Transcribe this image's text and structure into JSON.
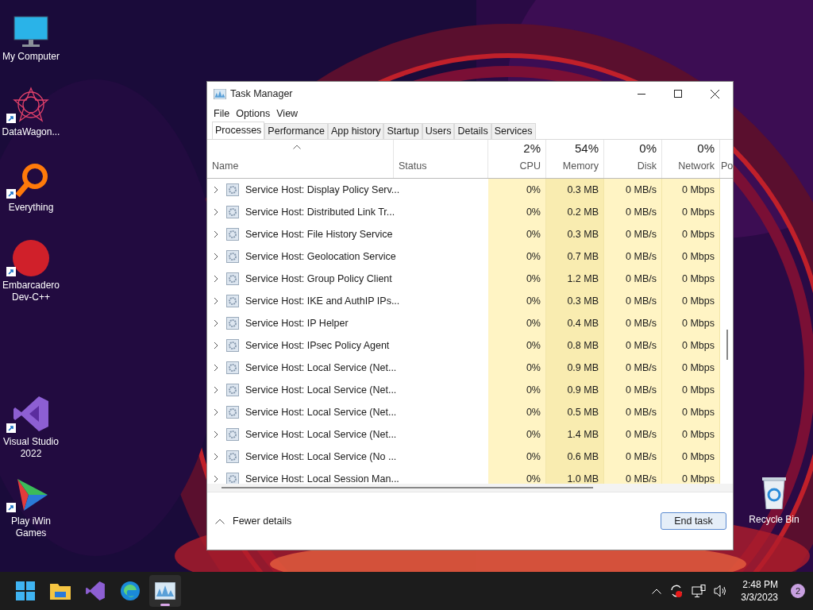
{
  "desktop_icons": [
    {
      "label": "My Computer",
      "kind": "monitor",
      "shortcut": false
    },
    {
      "label": "DataWagon...",
      "kind": "star",
      "shortcut": true
    },
    {
      "label": "Everything",
      "kind": "magnifier",
      "shortcut": true
    },
    {
      "label": "Embarcadero Dev-C++",
      "kind": "devcpp",
      "shortcut": true
    },
    {
      "label": "Visual Studio 2022",
      "kind": "vs",
      "shortcut": true
    },
    {
      "label": "Play iWin Games",
      "kind": "play",
      "shortcut": true
    }
  ],
  "recycle_bin": {
    "label": "Recycle Bin"
  },
  "window": {
    "title": "Task Manager",
    "menu": [
      "File",
      "Options",
      "View"
    ],
    "tabs": [
      {
        "label": "Processes",
        "selected": true
      },
      {
        "label": "Performance",
        "selected": false
      },
      {
        "label": "App history",
        "selected": false
      },
      {
        "label": "Startup",
        "selected": false
      },
      {
        "label": "Users",
        "selected": false
      },
      {
        "label": "Details",
        "selected": false
      },
      {
        "label": "Services",
        "selected": false
      }
    ],
    "columns": [
      {
        "label": "Name",
        "kind": "name"
      },
      {
        "label": "Status",
        "kind": "status"
      },
      {
        "label": "CPU",
        "total": "2%",
        "kind": "metric"
      },
      {
        "label": "Memory",
        "total": "54%",
        "kind": "metric"
      },
      {
        "label": "Disk",
        "total": "0%",
        "kind": "metric"
      },
      {
        "label": "Network",
        "total": "0%",
        "kind": "metric"
      },
      {
        "label": "Po",
        "kind": "cut"
      }
    ],
    "rows": [
      {
        "name": "Service Host: Display Policy Serv...",
        "cpu": "0%",
        "memory": "0.3 MB",
        "disk": "0 MB/s",
        "network": "0 Mbps",
        "expanded": false
      },
      {
        "name": "Service Host: Distributed Link Tr...",
        "cpu": "0%",
        "memory": "0.2 MB",
        "disk": "0 MB/s",
        "network": "0 Mbps",
        "expanded": false
      },
      {
        "name": "Service Host: File History Service",
        "cpu": "0%",
        "memory": "0.3 MB",
        "disk": "0 MB/s",
        "network": "0 Mbps",
        "expanded": false
      },
      {
        "name": "Service Host: Geolocation Service",
        "cpu": "0%",
        "memory": "0.7 MB",
        "disk": "0 MB/s",
        "network": "0 Mbps",
        "expanded": false
      },
      {
        "name": "Service Host: Group Policy Client",
        "cpu": "0%",
        "memory": "1.2 MB",
        "disk": "0 MB/s",
        "network": "0 Mbps",
        "expanded": false
      },
      {
        "name": "Service Host: IKE and AuthIP IPs...",
        "cpu": "0%",
        "memory": "0.3 MB",
        "disk": "0 MB/s",
        "network": "0 Mbps",
        "expanded": false
      },
      {
        "name": "Service Host: IP Helper",
        "cpu": "0%",
        "memory": "0.4 MB",
        "disk": "0 MB/s",
        "network": "0 Mbps",
        "expanded": false
      },
      {
        "name": "Service Host: IPsec Policy Agent",
        "cpu": "0%",
        "memory": "0.8 MB",
        "disk": "0 MB/s",
        "network": "0 Mbps",
        "expanded": false
      },
      {
        "name": "Service Host: Local Service (Net...",
        "cpu": "0%",
        "memory": "0.9 MB",
        "disk": "0 MB/s",
        "network": "0 Mbps",
        "expanded": false
      },
      {
        "name": "Service Host: Local Service (Net...",
        "cpu": "0%",
        "memory": "0.9 MB",
        "disk": "0 MB/s",
        "network": "0 Mbps",
        "expanded": false
      },
      {
        "name": "Service Host: Local Service (Net...",
        "cpu": "0%",
        "memory": "0.5 MB",
        "disk": "0 MB/s",
        "network": "0 Mbps",
        "expanded": false
      },
      {
        "name": "Service Host: Local Service (Net...",
        "cpu": "0%",
        "memory": "1.4 MB",
        "disk": "0 MB/s",
        "network": "0 Mbps",
        "expanded": false
      },
      {
        "name": "Service Host: Local Service (No ...",
        "cpu": "0%",
        "memory": "0.6 MB",
        "disk": "0 MB/s",
        "network": "0 Mbps",
        "expanded": false
      },
      {
        "name": "Service Host: Local Session Man...",
        "cpu": "0%",
        "memory": "1.0 MB",
        "disk": "0 MB/s",
        "network": "0 Mbps",
        "expanded": false
      }
    ],
    "footer": {
      "toggle": "Fewer details",
      "button": "End task"
    }
  },
  "taskbar": {
    "apps": [
      {
        "kind": "start",
        "selected": false
      },
      {
        "kind": "folder",
        "selected": false
      },
      {
        "kind": "vs",
        "selected": false
      },
      {
        "kind": "edge",
        "selected": false
      },
      {
        "kind": "taskmgr",
        "selected": true
      }
    ],
    "tray": {
      "time": "2:48 PM",
      "date": "3/3/2023",
      "notifications": "2"
    }
  }
}
